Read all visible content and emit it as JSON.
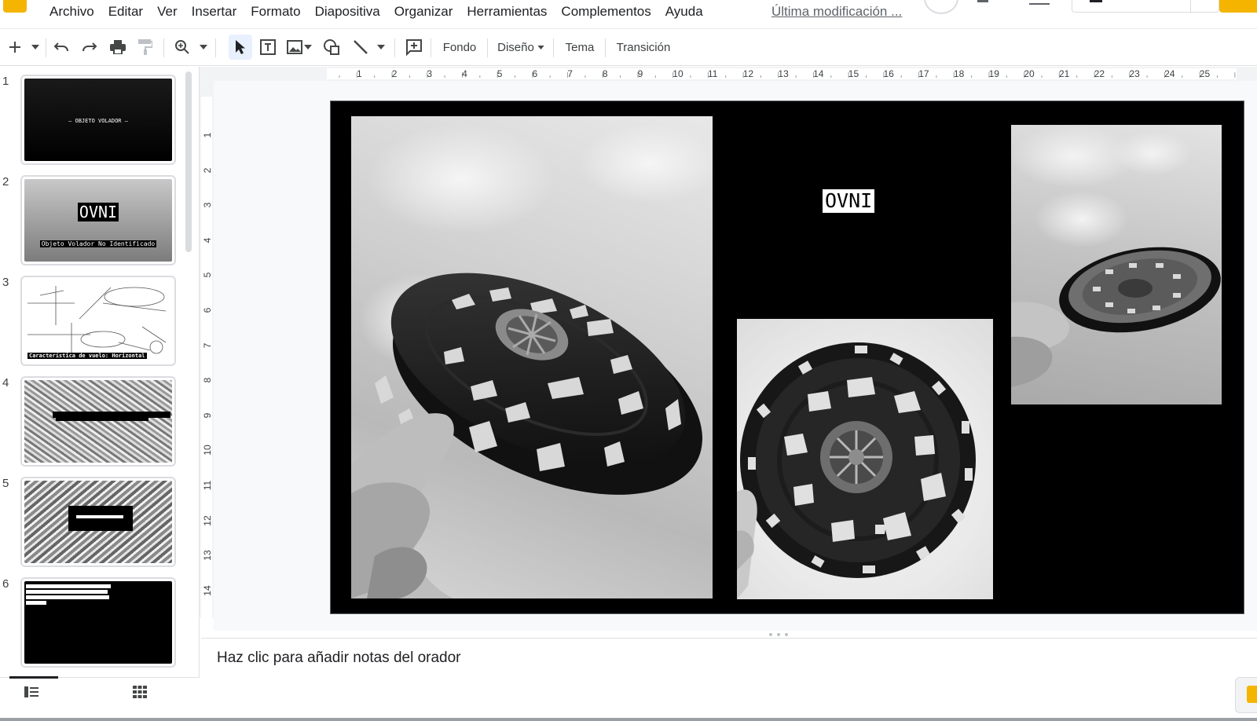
{
  "menubar": {
    "items": [
      "Archivo",
      "Editar",
      "Ver",
      "Insertar",
      "Formato",
      "Diapositiva",
      "Organizar",
      "Herramientas",
      "Complementos",
      "Ayuda"
    ],
    "last_modified": "Última modificación ..."
  },
  "toolbar": {
    "background_label": "Fondo",
    "layout_label": "Diseño",
    "theme_label": "Tema",
    "transition_label": "Transición"
  },
  "filmstrip": {
    "slides": [
      {
        "number": "1",
        "text": "– OBJETO VOLADOR –"
      },
      {
        "number": "2",
        "title": "OVNI",
        "subtitle": "Objeto Volador No Identificado"
      },
      {
        "number": "3",
        "caption": "Característica de vuelo: Horizontal"
      },
      {
        "number": "4"
      },
      {
        "number": "5"
      },
      {
        "number": "6"
      }
    ]
  },
  "ruler": {
    "top": [
      "1",
      "2",
      "3",
      "4",
      "5",
      "6",
      "7",
      "8",
      "9",
      "10",
      "11",
      "12",
      "13",
      "14",
      "15",
      "16",
      "17",
      "18",
      "19",
      "20",
      "21",
      "22",
      "23",
      "24",
      "25"
    ],
    "left": [
      "1",
      "2",
      "3",
      "4",
      "5",
      "6",
      "7",
      "8",
      "9",
      "10",
      "11",
      "12",
      "13",
      "14"
    ]
  },
  "slide": {
    "title": "OVNI"
  },
  "notes": {
    "placeholder": "Haz clic para añadir notas del orador"
  },
  "colors": {
    "accent": "#f4b400",
    "selection": "#e8f0fe"
  }
}
